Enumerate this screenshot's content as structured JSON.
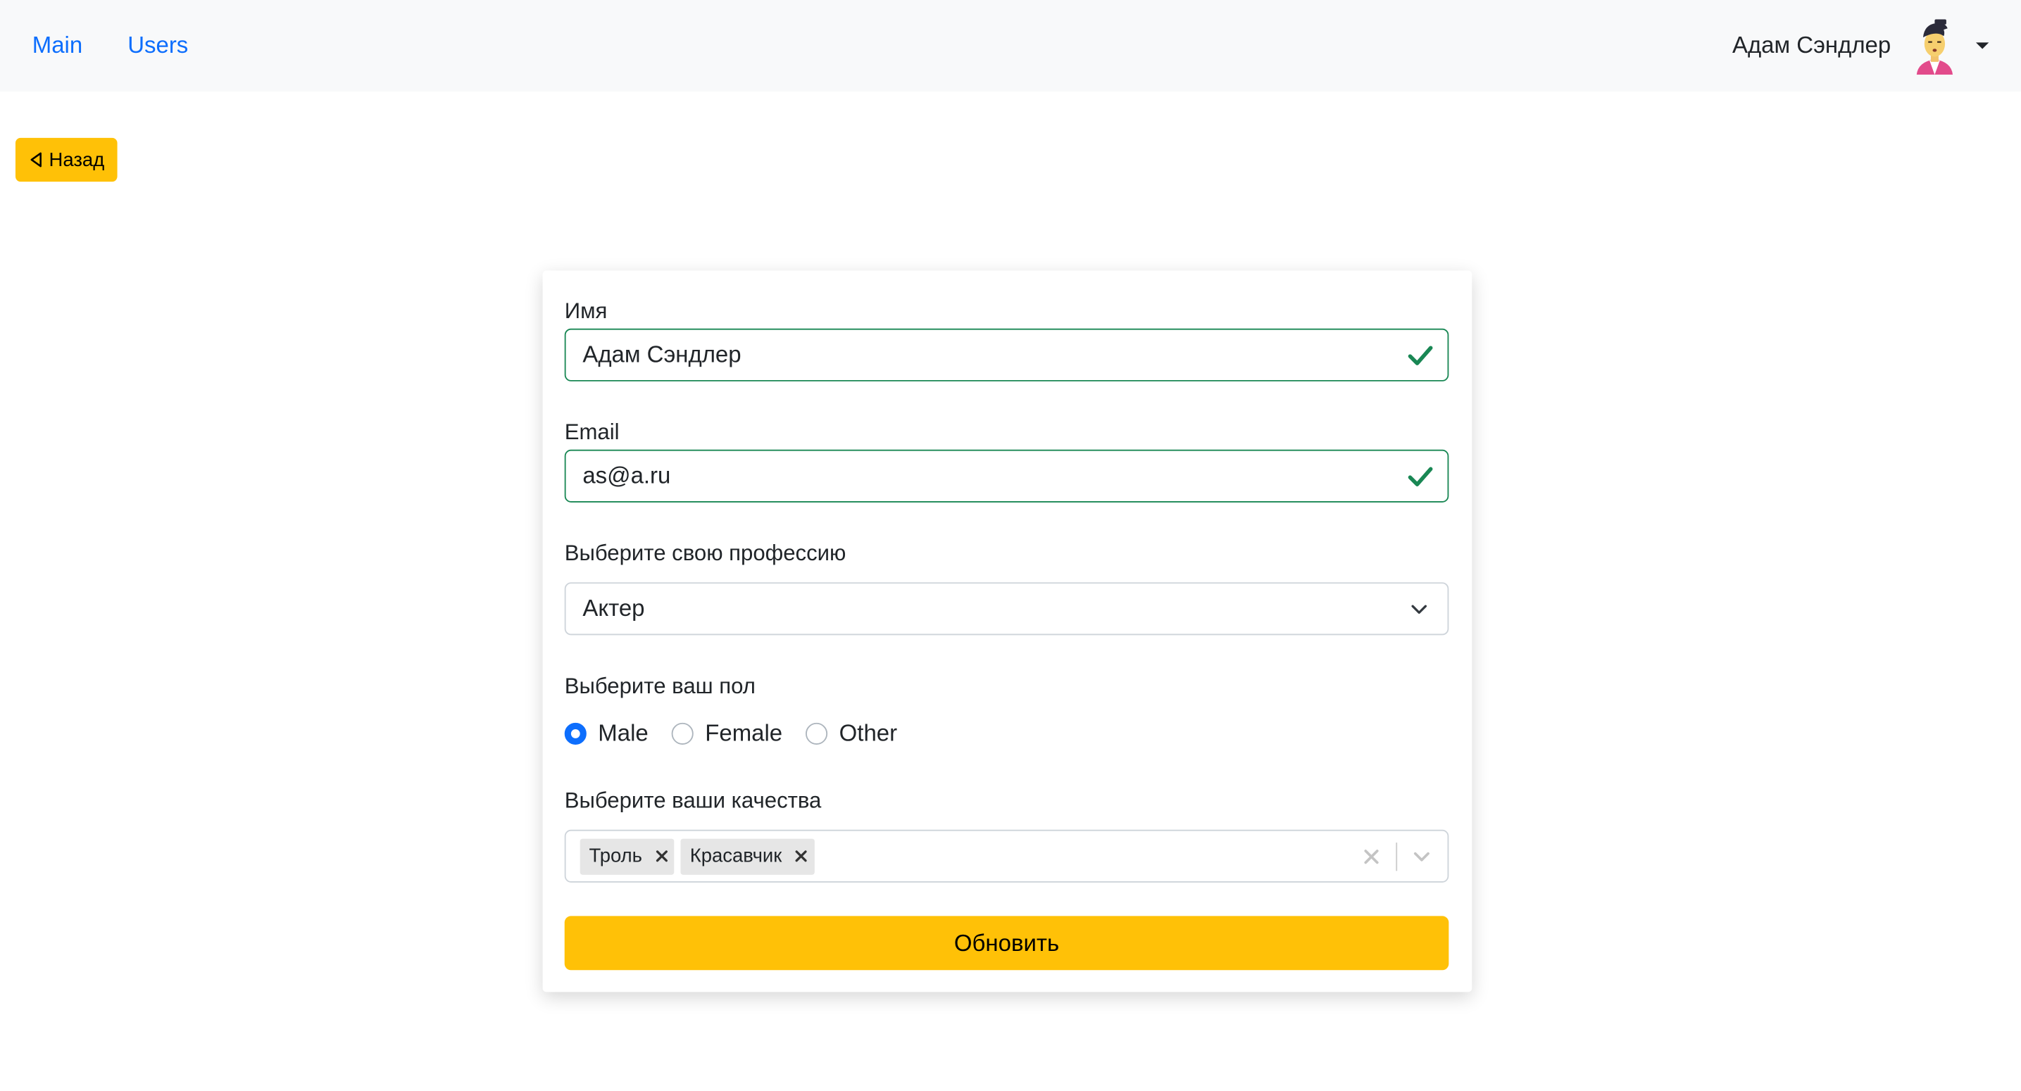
{
  "navbar": {
    "links": [
      {
        "label": "Main"
      },
      {
        "label": "Users"
      }
    ],
    "user_name": "Адам Сэндлер"
  },
  "back_button": {
    "label": "Назад"
  },
  "form": {
    "name": {
      "label": "Имя",
      "value": "Адам Сэндлер",
      "valid": true
    },
    "email": {
      "label": "Email",
      "value": "as@a.ru",
      "valid": true
    },
    "profession": {
      "label": "Выберите свою профессию",
      "value": "Актер"
    },
    "sex": {
      "label": "Выберите ваш пол",
      "options": [
        {
          "label": "Male",
          "checked": true
        },
        {
          "label": "Female",
          "checked": false
        },
        {
          "label": "Other",
          "checked": false
        }
      ]
    },
    "qualities": {
      "label": "Выберите ваши качества",
      "selected": [
        {
          "label": "Троль"
        },
        {
          "label": "Красавчик"
        }
      ]
    },
    "submit_label": "Обновить"
  },
  "colors": {
    "link": "#0d6efd",
    "accent": "#ffc107",
    "valid": "#198754",
    "navbar_bg": "#f8f9fa"
  }
}
